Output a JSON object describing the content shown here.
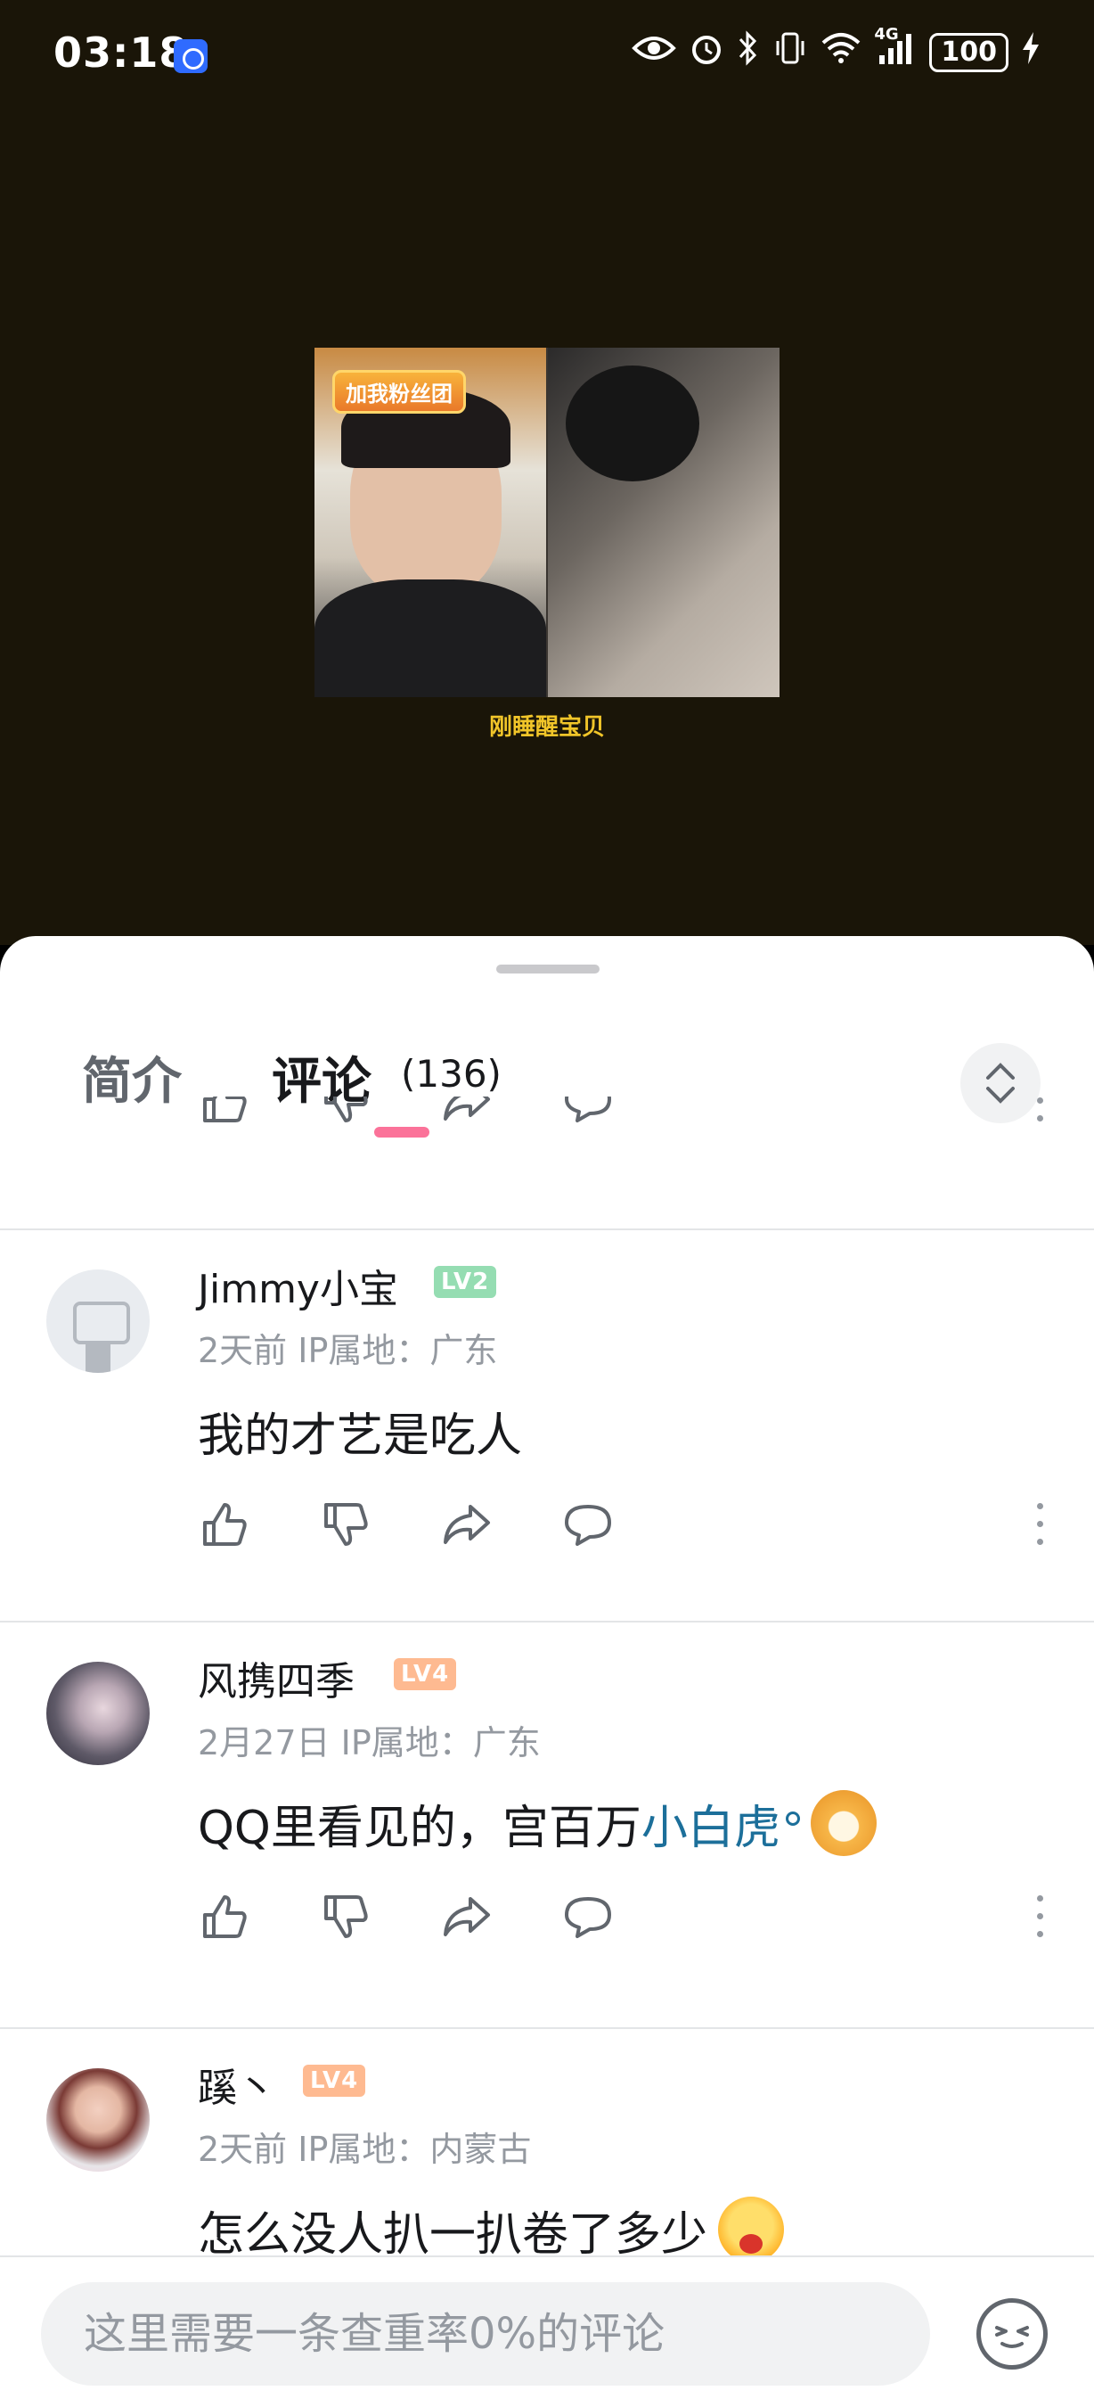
{
  "status_bar": {
    "time": "03:18",
    "network_label": "4G",
    "battery": "100",
    "icons": [
      "eye-icon",
      "alarm-icon",
      "bluetooth-icon",
      "vibrate-icon",
      "wifi-icon",
      "signal-icon",
      "battery-icon",
      "charging-icon"
    ]
  },
  "video": {
    "fan_badge": "加我粉丝团",
    "caption": "刚睡醒宝贝"
  },
  "tabs": {
    "intro": "简介",
    "comments": "评论",
    "comments_count": "(136)"
  },
  "comments": [
    {
      "username": "Jimmy小宝",
      "level": "LV2",
      "meta": "2天前 IP属地：广东",
      "text": "我的才艺是吃人"
    },
    {
      "username": "风携四季",
      "level": "LV4",
      "meta": "2月27日 IP属地：广东",
      "text_prefix": "QQ里看见的，宫百万",
      "link": "小白虎"
    },
    {
      "username": "蹊丶",
      "level": "LV4",
      "meta": "2天前 IP属地：内蒙古",
      "text": "怎么没人扒一扒卷了多少"
    }
  ],
  "input": {
    "placeholder": "这里需要一条查重率0%的评论"
  },
  "colors": {
    "accent_pink": "#fb7299",
    "link_blue": "#1c6f9a",
    "lv2_green": "#95ddb2",
    "lv4_orange": "#feba91",
    "video_bg": "#1a1508",
    "caption_yellow": "#f1c529"
  }
}
